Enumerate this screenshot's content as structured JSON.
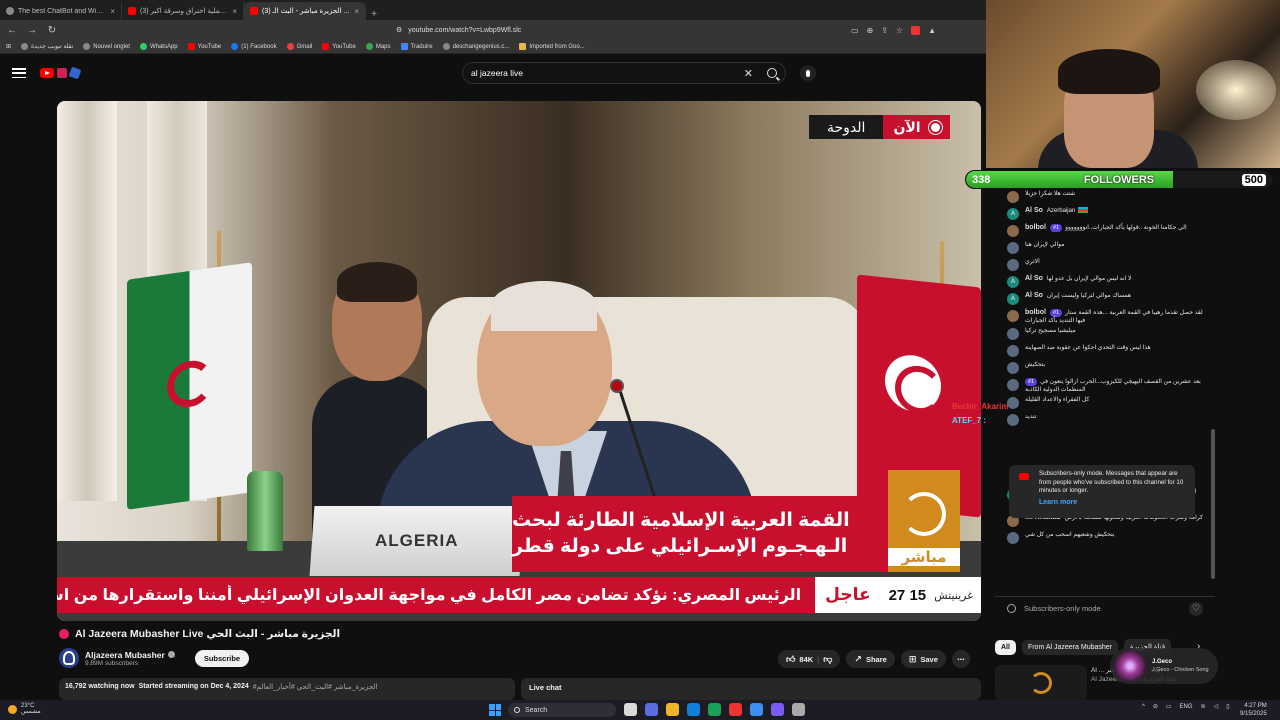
{
  "browser": {
    "tabs": [
      {
        "title": "The best ChatBot and Widgets for Y..."
      },
      {
        "title": "(3) كيف تمت عملية اختراق وسرقة اكبر ..."
      },
      {
        "title": "(3) الجزيرة مباشر - البث الـ ..."
      }
    ],
    "url": "youtube.com/watch?v=Lwbp9Wfl.slc",
    "bookmarks": [
      "نقلة تبويب جديدة",
      "Nouvel onglet",
      "WhatsApp",
      "YouTube",
      "(1) Facebook",
      "Gmail",
      "YouTube",
      "Maps",
      "Traduire",
      "deschangegenius.c...",
      "Imported from Goo..."
    ]
  },
  "header": {
    "search_query": "al jazeera live"
  },
  "video": {
    "live_now": "الآن",
    "city": "الدوحة",
    "nameplate": "ALGERIA",
    "headline_line1": "القمة العربية الإسلامية الطارئة لبحث",
    "headline_line2": "الـهـجـوم الإسـرائيلي على دولة قطر",
    "channel_logo_label": "مباشر",
    "ticker_zone": "غرينيتش",
    "ticker_time": "15 27",
    "ticker_urgent": "عاجل",
    "ticker_text": "الرئيس المصري: نؤكد تضامن مصر الكامل في مواجهة العدوان الإسرائيلي       أمننا واستقرارها من استقرارنا"
  },
  "watch": {
    "title": "Al Jazeera Mubasher Live الجزيرة مباشر - البث الحي",
    "channel": "Aljazeera Mubasher",
    "subscribers": "9.89M subscribers",
    "subscribe_label": "Subscribe",
    "likes": "84K",
    "share_label": "Share",
    "save_label": "Save",
    "watching": "16,792 watching now",
    "started": "Started streaming on Dec 4, 2024",
    "tags": "#الجزيرة_مباشر #البث_الحي #أخبار_العالم",
    "live_chat_label": "Live chat"
  },
  "stream_overlay": {
    "followers_current": "338",
    "followers_label": "FOLLOWERS",
    "followers_goal": "500",
    "followers_progress": 0.676,
    "name1": "Bechir_Akarim",
    "name2": "ATEF_7 :"
  },
  "chat": {
    "messages": [
      {
        "author": "",
        "text": "شتت هلا شكرا جزيلا",
        "avatar": "p"
      },
      {
        "author": "Al So",
        "text": "Azerbaijan",
        "avatar": "t",
        "flag": true
      },
      {
        "author": "bolbol",
        "badge": "#1",
        "text": "الي حكامنا الخونة ..قولها بأكد الجبارات..انووووووو",
        "avatar": "p"
      },
      {
        "author": "",
        "text": "موالي لإيران هنا",
        "avatar": ""
      },
      {
        "author": "",
        "text": "الاتري",
        "avatar": ""
      },
      {
        "author": "Al So",
        "text": "لا انه ليس موالي لإيران بل عدو لها",
        "avatar": "t"
      },
      {
        "author": "Al So",
        "text": "همساك موالي لتركيا وليست إيران",
        "avatar": "t"
      },
      {
        "author": "bolbol",
        "badge": "#1",
        "text": "لقد حصل تقدما رهيبا في القمة العربية ...هذه القمة ستار فيها التنديد بأكد الجبارات",
        "avatar": "p"
      },
      {
        "author": "",
        "text": "ميليشيا مسجيح تركيا",
        "avatar": ""
      },
      {
        "author": "",
        "text": "هذا ليس وقت التحدي احكوا عن عقوبة ضد الصهاينة",
        "avatar": ""
      },
      {
        "author": "",
        "text": "بتحكيش",
        "avatar": ""
      },
      {
        "author": "",
        "badge": "#1",
        "text": "بعد عشرين من القصف البهيجي للكيزوب...الحرب ازالوا يتعون في المنظمات الدولية الكاذبة",
        "avatar": ""
      },
      {
        "author": "",
        "text": "كل الفقراء والاعداد القليلة",
        "avatar": ""
      },
      {
        "author": "",
        "text": "تنديد",
        "avatar": ""
      }
    ],
    "notice_text": "Subscribers-only mode. Messages that appear are from people who've subscribed to this channel for 10 minutes or longer.",
    "notice_link": "Learn more",
    "messages_after": [
      {
        "author": "Samir Media",
        "text": "اللهم احفظ قطر وأميرها وحكامها وأهلها من كل شر يارب العالمين",
        "avatar": "t",
        "hearts": "▮▮▮▮▮▮▮▮ ❤"
      },
      {
        "author": "M. Khattab",
        "text": "كرامة وشرف الحكومات العربية وشعوبها مسحت بالارض",
        "avatar": "p"
      },
      {
        "author": "",
        "text": "بتحكيش وشعبهم اسحب من كل شي",
        "avatar": ""
      }
    ],
    "footer_label": "Subscribers-only mode"
  },
  "recommend": {
    "chips": [
      "All",
      "From Al Jazeera Mubasher",
      "قناة الجزيرة"
    ],
    "card_title": "Al ... البث ... الحي المباشر",
    "card_channel": "Al Jazeera Arabic قناة الجزيرة",
    "music_artist": "J.Geco",
    "music_track": "J.Geco - Chicken Song"
  },
  "taskbar": {
    "temp": "23°C",
    "weather_text": "مشمس",
    "search_label": "Search",
    "lang": "ENG",
    "time": "4:27 PM",
    "date": "9/15/2025"
  }
}
